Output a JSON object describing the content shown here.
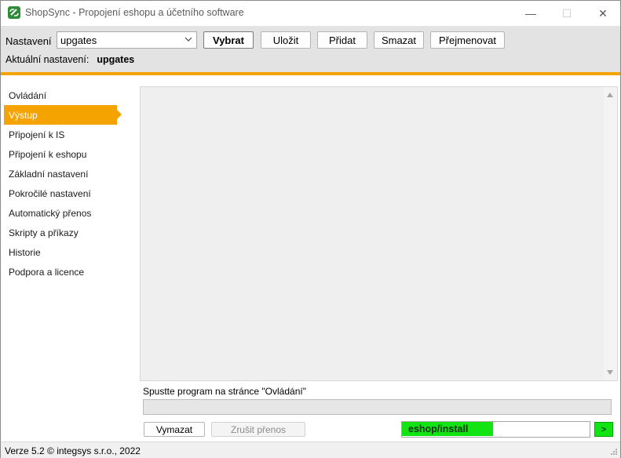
{
  "window": {
    "title": "ShopSync - Propojení eshopu a účetního software",
    "minimize_glyph": "—",
    "maximize_glyph": "☐",
    "close_glyph": "✕"
  },
  "toolbar": {
    "settings_label": "Nastavení",
    "settings_value": "upgates",
    "buttons": {
      "select": "Vybrat",
      "save": "Uložit",
      "add": "Přidat",
      "delete": "Smazat",
      "rename": "Přejmenovat"
    },
    "current_label": "Aktuální nastavení:",
    "current_value": "upgates"
  },
  "sidebar": {
    "active_index": 1,
    "items": [
      {
        "label": "Ovládání"
      },
      {
        "label": "Výstup"
      },
      {
        "label": "Připojení k IS"
      },
      {
        "label": "Připojení k eshopu"
      },
      {
        "label": "Základní nastavení"
      },
      {
        "label": "Pokročilé nastavení"
      },
      {
        "label": "Automatický přenos"
      },
      {
        "label": "Skripty a příkazy"
      },
      {
        "label": "Historie"
      },
      {
        "label": "Podpora a licence"
      }
    ]
  },
  "output": {
    "status_text": "Spustte program na stránce \"Ovládání\"",
    "progress": 0
  },
  "bottom": {
    "clear_label": "Vymazat",
    "cancel_label": "Zrušit přenos",
    "command_value": "eshop/install",
    "go_label": ">"
  },
  "statusbar": {
    "version_text": "Verze 5.2  © integsys s.r.o., 2022"
  },
  "colors": {
    "accent": "#f5a300",
    "toolbar_bg": "#e3e3e3",
    "command_highlight": "#12e312"
  }
}
